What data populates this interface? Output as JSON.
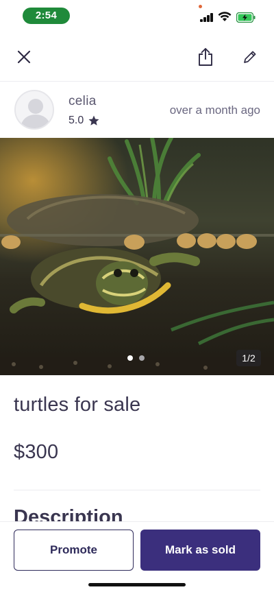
{
  "status_bar": {
    "time": "2:54"
  },
  "nav": {
    "close_icon": "close-icon",
    "share_icon": "share-icon",
    "edit_icon": "edit-pencil-icon"
  },
  "seller": {
    "name": "celia",
    "rating": "5.0",
    "posted": "over a month  ago"
  },
  "photo": {
    "description_icon": "turtle-photo",
    "current_index": 1,
    "total": 2,
    "counter": "1/2"
  },
  "listing": {
    "title": "turtles for sale",
    "price": "$300",
    "description_heading": "Description"
  },
  "actions": {
    "promote_label": "Promote",
    "mark_sold_label": "Mark as sold"
  },
  "colors": {
    "primary": "#3b2f7d",
    "time_pill": "#1f8a3a",
    "text": "#3a3650"
  }
}
